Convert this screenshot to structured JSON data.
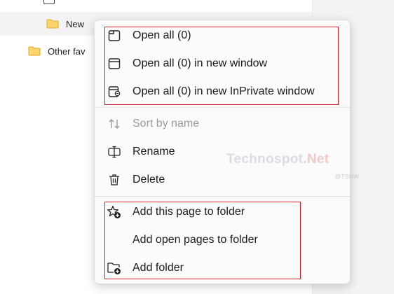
{
  "background": {
    "new_folder_label": "New",
    "other_label": "Other fav"
  },
  "menu": {
    "group1": [
      {
        "label": "Open all (0)",
        "icon": "tab-icon"
      },
      {
        "label": "Open all (0) in new window",
        "icon": "window-icon"
      },
      {
        "label": "Open all (0) in new InPrivate window",
        "icon": "inprivate-window-icon"
      }
    ],
    "group2": [
      {
        "label": "Sort by name",
        "icon": "sort-icon",
        "disabled": true
      },
      {
        "label": "Rename",
        "icon": "rename-icon"
      },
      {
        "label": "Delete",
        "icon": "trash-icon"
      }
    ],
    "group3": [
      {
        "label": "Add this page to folder",
        "icon": "star-add-icon"
      },
      {
        "label": "Add open pages to folder",
        "icon": ""
      },
      {
        "label": "Add folder",
        "icon": "folder-add-icon"
      }
    ]
  },
  "watermark": {
    "brand": "Technospot",
    "brand_suffix": ".Net",
    "tag": "@TSNW"
  },
  "colors": {
    "highlight_border": "#d21f2b",
    "folder_yellow": "#f5c542",
    "menu_bg": "#fbfbfb"
  }
}
